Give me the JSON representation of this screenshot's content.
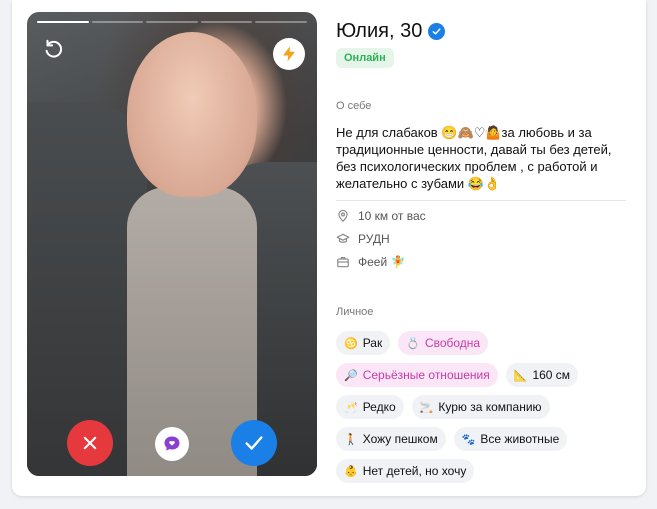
{
  "profile": {
    "name_age": "Юлия, 30",
    "status": "Онлайн",
    "about_label": "О себе",
    "about_text": "Не для слабаков 😁🙈♡🤷за любовь и за традиционные ценности, давай ты без детей, без психологических проблем , с работой и желательно с зубами 😂👌",
    "distance": "10 км от вас",
    "education": "РУДН",
    "job": "Феей 🧚",
    "personal_label": "Личное",
    "tags": [
      {
        "emoji": "♋",
        "label": "Рак",
        "highlight": false
      },
      {
        "emoji": "💍",
        "label": "Свободна",
        "highlight": true
      },
      {
        "emoji": "🔎",
        "label": "Серьёзные отношения",
        "highlight": true
      },
      {
        "emoji": "📐",
        "label": "160 см",
        "highlight": false
      },
      {
        "emoji": "🥂",
        "label": "Редко",
        "highlight": false
      },
      {
        "emoji": "🚬",
        "label": "Курю за компанию",
        "highlight": false
      },
      {
        "emoji": "🚶",
        "label": "Хожу пешком",
        "highlight": false
      },
      {
        "emoji": "🐾",
        "label": "Все животные",
        "highlight": false
      },
      {
        "emoji": "👶",
        "label": "Нет детей, но хочу",
        "highlight": false
      }
    ]
  },
  "photo": {
    "total_photos": 5,
    "current_photo": 1
  },
  "colors": {
    "dislike": "#e6393e",
    "like": "#1a7fe6",
    "online": "#2bb157",
    "highlight_tag": "#c53ca8"
  },
  "icons": {
    "undo": "undo-icon",
    "boost": "lightning-icon",
    "dislike": "close-icon",
    "message": "chat-bubble-icon",
    "like": "checkmark-icon",
    "verified": "verified-badge-icon",
    "location": "location-pin-icon",
    "education": "graduation-cap-icon",
    "job": "briefcase-icon"
  }
}
